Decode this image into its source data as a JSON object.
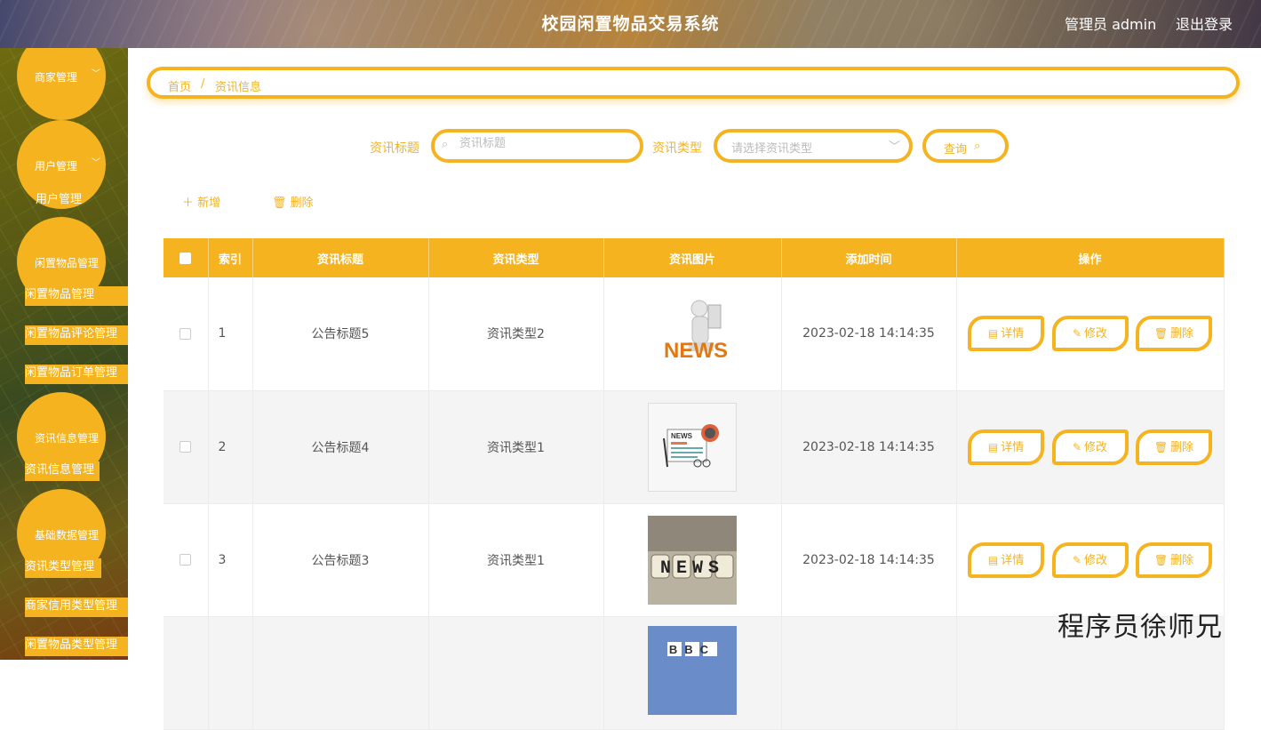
{
  "header": {
    "title": "校园闲置物品交易系统",
    "user": "管理员 admin",
    "logout": "退出登录"
  },
  "sidebar": {
    "menus": [
      {
        "label": "商家管理",
        "subs": []
      },
      {
        "label": "用户管理",
        "subs": [
          "用户管理"
        ]
      },
      {
        "label": "闲置物品管理",
        "subs": [
          "闲置物品管理",
          "闲置物品评论管理",
          "闲置物品订单管理"
        ]
      },
      {
        "label": "资讯信息管理",
        "subs": [
          "资讯信息管理"
        ]
      },
      {
        "label": "基础数据管理",
        "subs": [
          "资讯类型管理",
          "商家信用类型管理",
          "闲置物品类型管理"
        ]
      }
    ]
  },
  "breadcrumb": {
    "home": "首页",
    "separator": "/",
    "current": "资讯信息"
  },
  "search": {
    "title_label": "资讯标题",
    "title_placeholder": "资讯标题",
    "type_label": "资讯类型",
    "type_placeholder": "请选择资讯类型",
    "query_label": "查询"
  },
  "actions": {
    "add": "新增",
    "delete": "删除"
  },
  "table": {
    "columns": [
      "索引",
      "资讯标题",
      "资讯类型",
      "资讯图片",
      "添加时间",
      "操作"
    ],
    "rows": [
      {
        "index": "1",
        "title": "公告标题5",
        "type": "资讯类型2",
        "image": "news-3d-figure",
        "time": "2023-02-18 14:14:35"
      },
      {
        "index": "2",
        "title": "公告标题4",
        "type": "资讯类型1",
        "image": "news-newspaper-glasses",
        "time": "2023-02-18 14:14:35"
      },
      {
        "index": "3",
        "title": "公告标题3",
        "type": "资讯类型1",
        "image": "news-letter-tiles",
        "time": "2023-02-18 14:14:35"
      },
      {
        "index": "",
        "title": "",
        "type": "",
        "image": "bbc-logo",
        "time": ""
      }
    ],
    "row_actions": {
      "detail": "详情",
      "edit": "修改",
      "delete": "删除"
    }
  },
  "images": {
    "bbc_text": "BBC",
    "news_text": "NEWS"
  },
  "watermark": "程序员徐师兄",
  "colors": {
    "accent": "#f5b320"
  }
}
